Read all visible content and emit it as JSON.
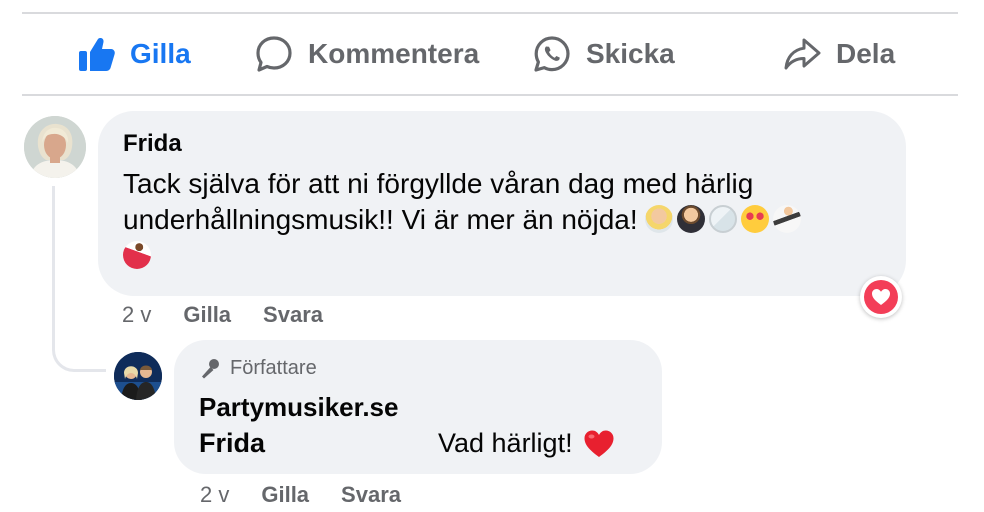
{
  "actions": {
    "like": "Gilla",
    "comment": "Kommentera",
    "send": "Skicka",
    "share": "Dela"
  },
  "comment": {
    "author": "Frida",
    "text": "Tack själva för att ni förgyllde våran dag med härlig underhållningsmusik!! Vi är mer än nöjda!",
    "emojis": [
      "woman-technologist-emoji",
      "man-in-tuxedo-emoji",
      "clinking-glasses-emoji",
      "heart-eyes-emoji",
      "man-dancing-emoji",
      "woman-dancing-emoji"
    ],
    "time": "2 v",
    "like_label": "Gilla",
    "reply_label": "Svara",
    "reaction": "heart"
  },
  "reply": {
    "badge": "Författare",
    "author": "Partymusiker.se",
    "tag": "Frida",
    "text": "Vad härligt!",
    "emoji": "red-heart",
    "time": "2 v",
    "like_label": "Gilla",
    "reply_label": "Svara"
  },
  "colors": {
    "accent": "#1877f2",
    "muted": "#65676b",
    "bubble": "#f0f2f5",
    "heart": "#f33e58"
  }
}
